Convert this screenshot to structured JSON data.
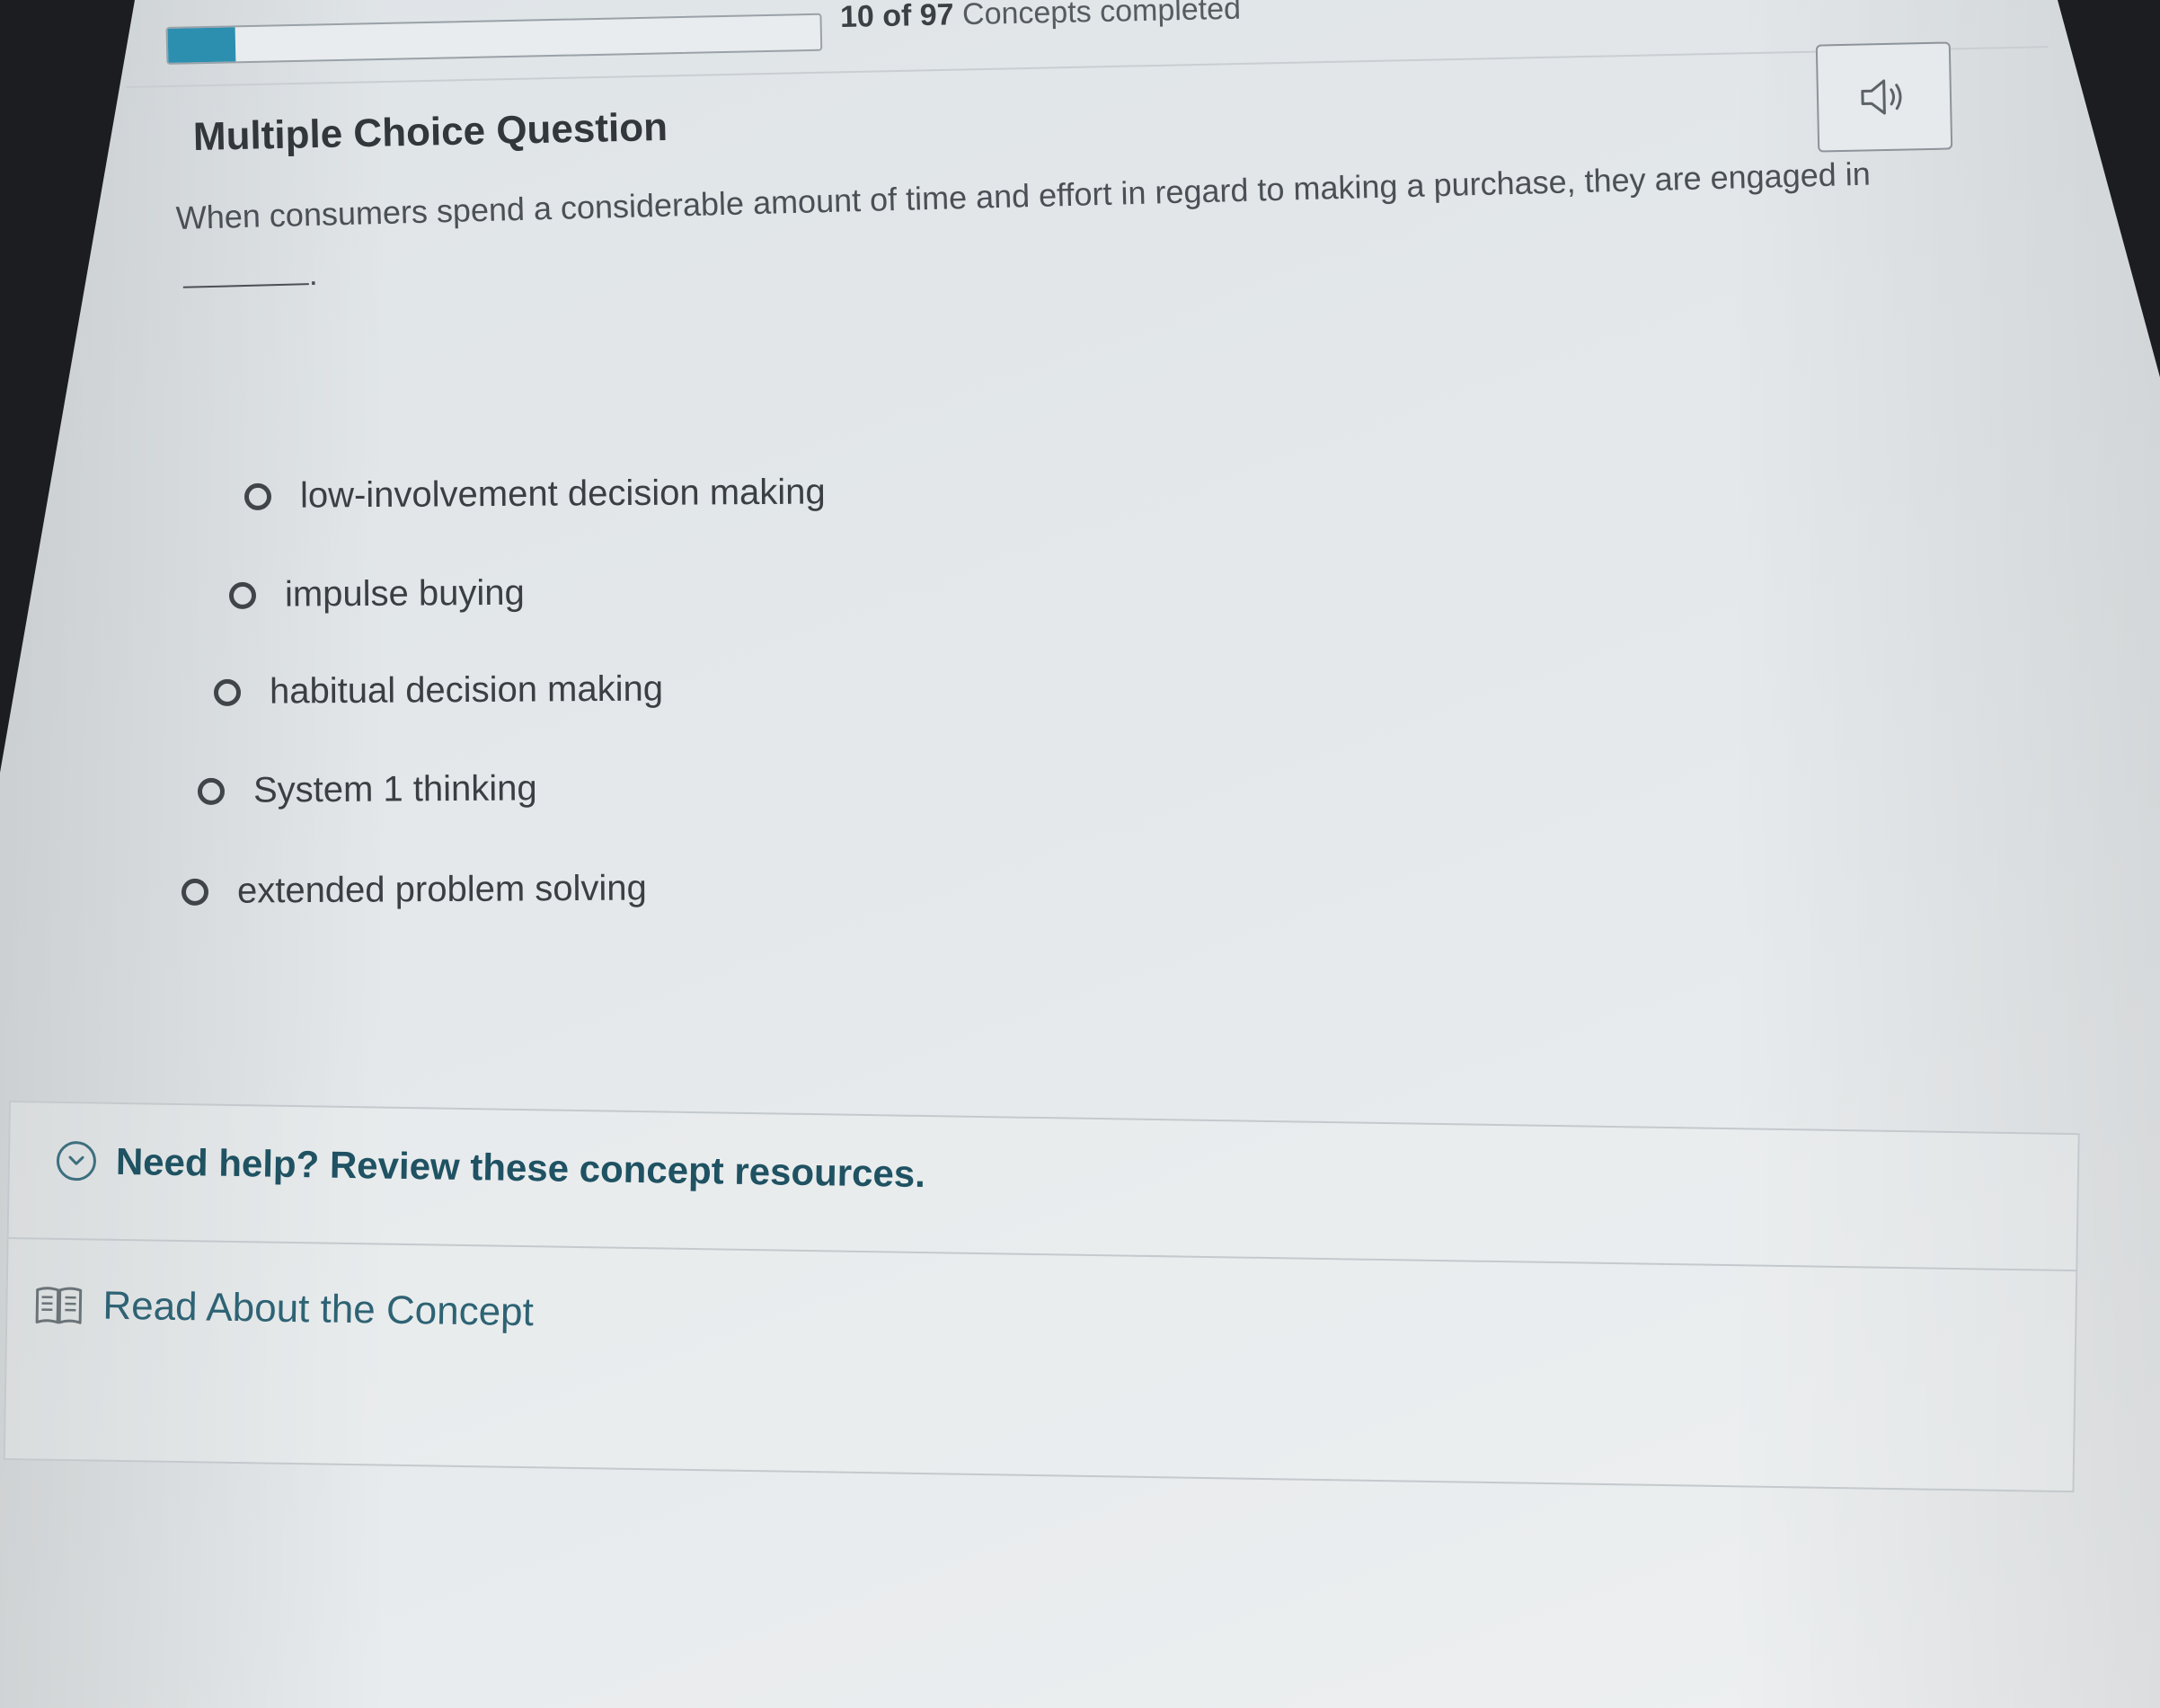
{
  "progress": {
    "completed": "10",
    "of_word": "of",
    "total": "97",
    "label": "Concepts completed",
    "fraction": 0.103,
    "badge": "1",
    "fill_color": "#2c8fb0"
  },
  "toolbar": {
    "audio_icon": "speaker-icon"
  },
  "question": {
    "type": "Multiple Choice Question",
    "text": "When consumers spend a considerable amount of time and effort in regard to making a purchase, they are engaged in",
    "blank_suffix": "."
  },
  "choices": [
    {
      "label": "low-involvement decision making"
    },
    {
      "label": "impulse buying"
    },
    {
      "label": "habitual decision making"
    },
    {
      "label": "System 1 thinking"
    },
    {
      "label": "extended problem solving"
    }
  ],
  "help": {
    "title": "Need help? Review these concept resources.",
    "icon": "chevron-down-circle-icon",
    "resources": [
      {
        "label": "Read About the Concept",
        "icon": "book-icon"
      }
    ]
  }
}
